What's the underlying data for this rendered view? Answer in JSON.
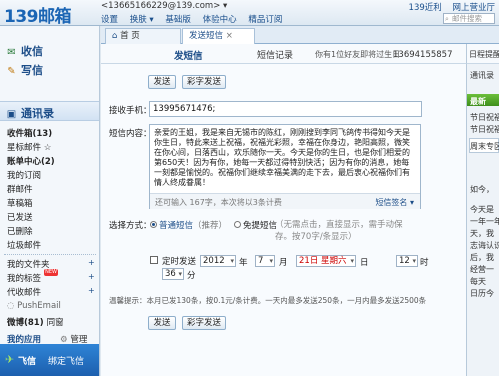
{
  "top": {
    "logo": "139邮箱",
    "account": "<13665166229@139.com> ▾",
    "menu": [
      "设置",
      "换肤 ▾",
      "基础版",
      "体验中心",
      "精品订阅"
    ],
    "links": [
      "139近利",
      "网上营业厅"
    ],
    "search_placeholder": "邮件搜索"
  },
  "sidebar": {
    "inbox": "收信",
    "compose": "写信",
    "contacts": "通讯录",
    "items": [
      "收件箱(13)",
      "星标邮件 ☆",
      "账单中心(2)",
      "我的订阅",
      "群邮件",
      "草稿箱",
      "已发送",
      "已删除",
      "垃圾邮件"
    ],
    "folders": [
      "我的文件夹",
      "我的标签",
      "代收邮件",
      "PushEmail",
      "微博(81)"
    ],
    "folder_extra": "同窗",
    "apps_title": "我的应用",
    "apps_manage": "管理",
    "fly": "飞信",
    "bind_fly": "绑定飞信"
  },
  "tabs": [
    "首 页",
    "发送短信"
  ],
  "subhead": {
    "send_sms": "发短信",
    "sms_record": "短信记录",
    "info": "你有1位好友即将过生日",
    "number": "13694155857",
    "schedule": "日程提醒"
  },
  "form": {
    "send": "发送",
    "send_colorful": "彩字发送",
    "recipient_label": "接收手机：",
    "recipient_value": "13995671476;",
    "content_label": "短信内容：",
    "content": "亲爱的王姐，我是来自无锡市的陈红，刚刚搜到李同飞鸽传书得知今天是你生日，特此来送上祝福，祝福光彩照，幸福在你身边，艳阳高照，微笑在你心间，日落西山，欢乐随你一天。今天是你的生日，也是你们相爱的第650天！因为有你，她每一天都过得特别快活；因为有你的消息，她每一刻都是愉悦的。祝福你们继续幸福美满的走下去，最后衷心祝福你们有情人终成眷属！",
    "char_hint": "还可输入 167字，本次将以3条计费",
    "signature": "短信签名 ▾",
    "method_label": "选择方式：",
    "normal": "普通短信",
    "recommend": "（推荐）",
    "free": "免提短信",
    "free_note": "（无需点击，直接显示，需手动保存。按70字/条显示）",
    "timed": "定时发送",
    "year": "2012",
    "year_unit": "年",
    "month": "7",
    "month_unit": "月",
    "day": "21日 星期六",
    "day_unit": "日",
    "hour": "12",
    "hour_unit": "时",
    "minute": "36",
    "minute_unit": "分",
    "tip": "温馨提示：本月已发130条，按0.1元/条计费。一天内最多发送250条，一月内最多发送2500条"
  },
  "right": {
    "items": [
      "通讯录",
      "最新",
      "节日祝福",
      "节日祝福",
      "周末专区",
      "如今，",
      "今天是",
      "一年一年都",
      "天，我",
      "志诲认识",
      "后，我",
      "经营一",
      "每天",
      "日历今"
    ]
  }
}
